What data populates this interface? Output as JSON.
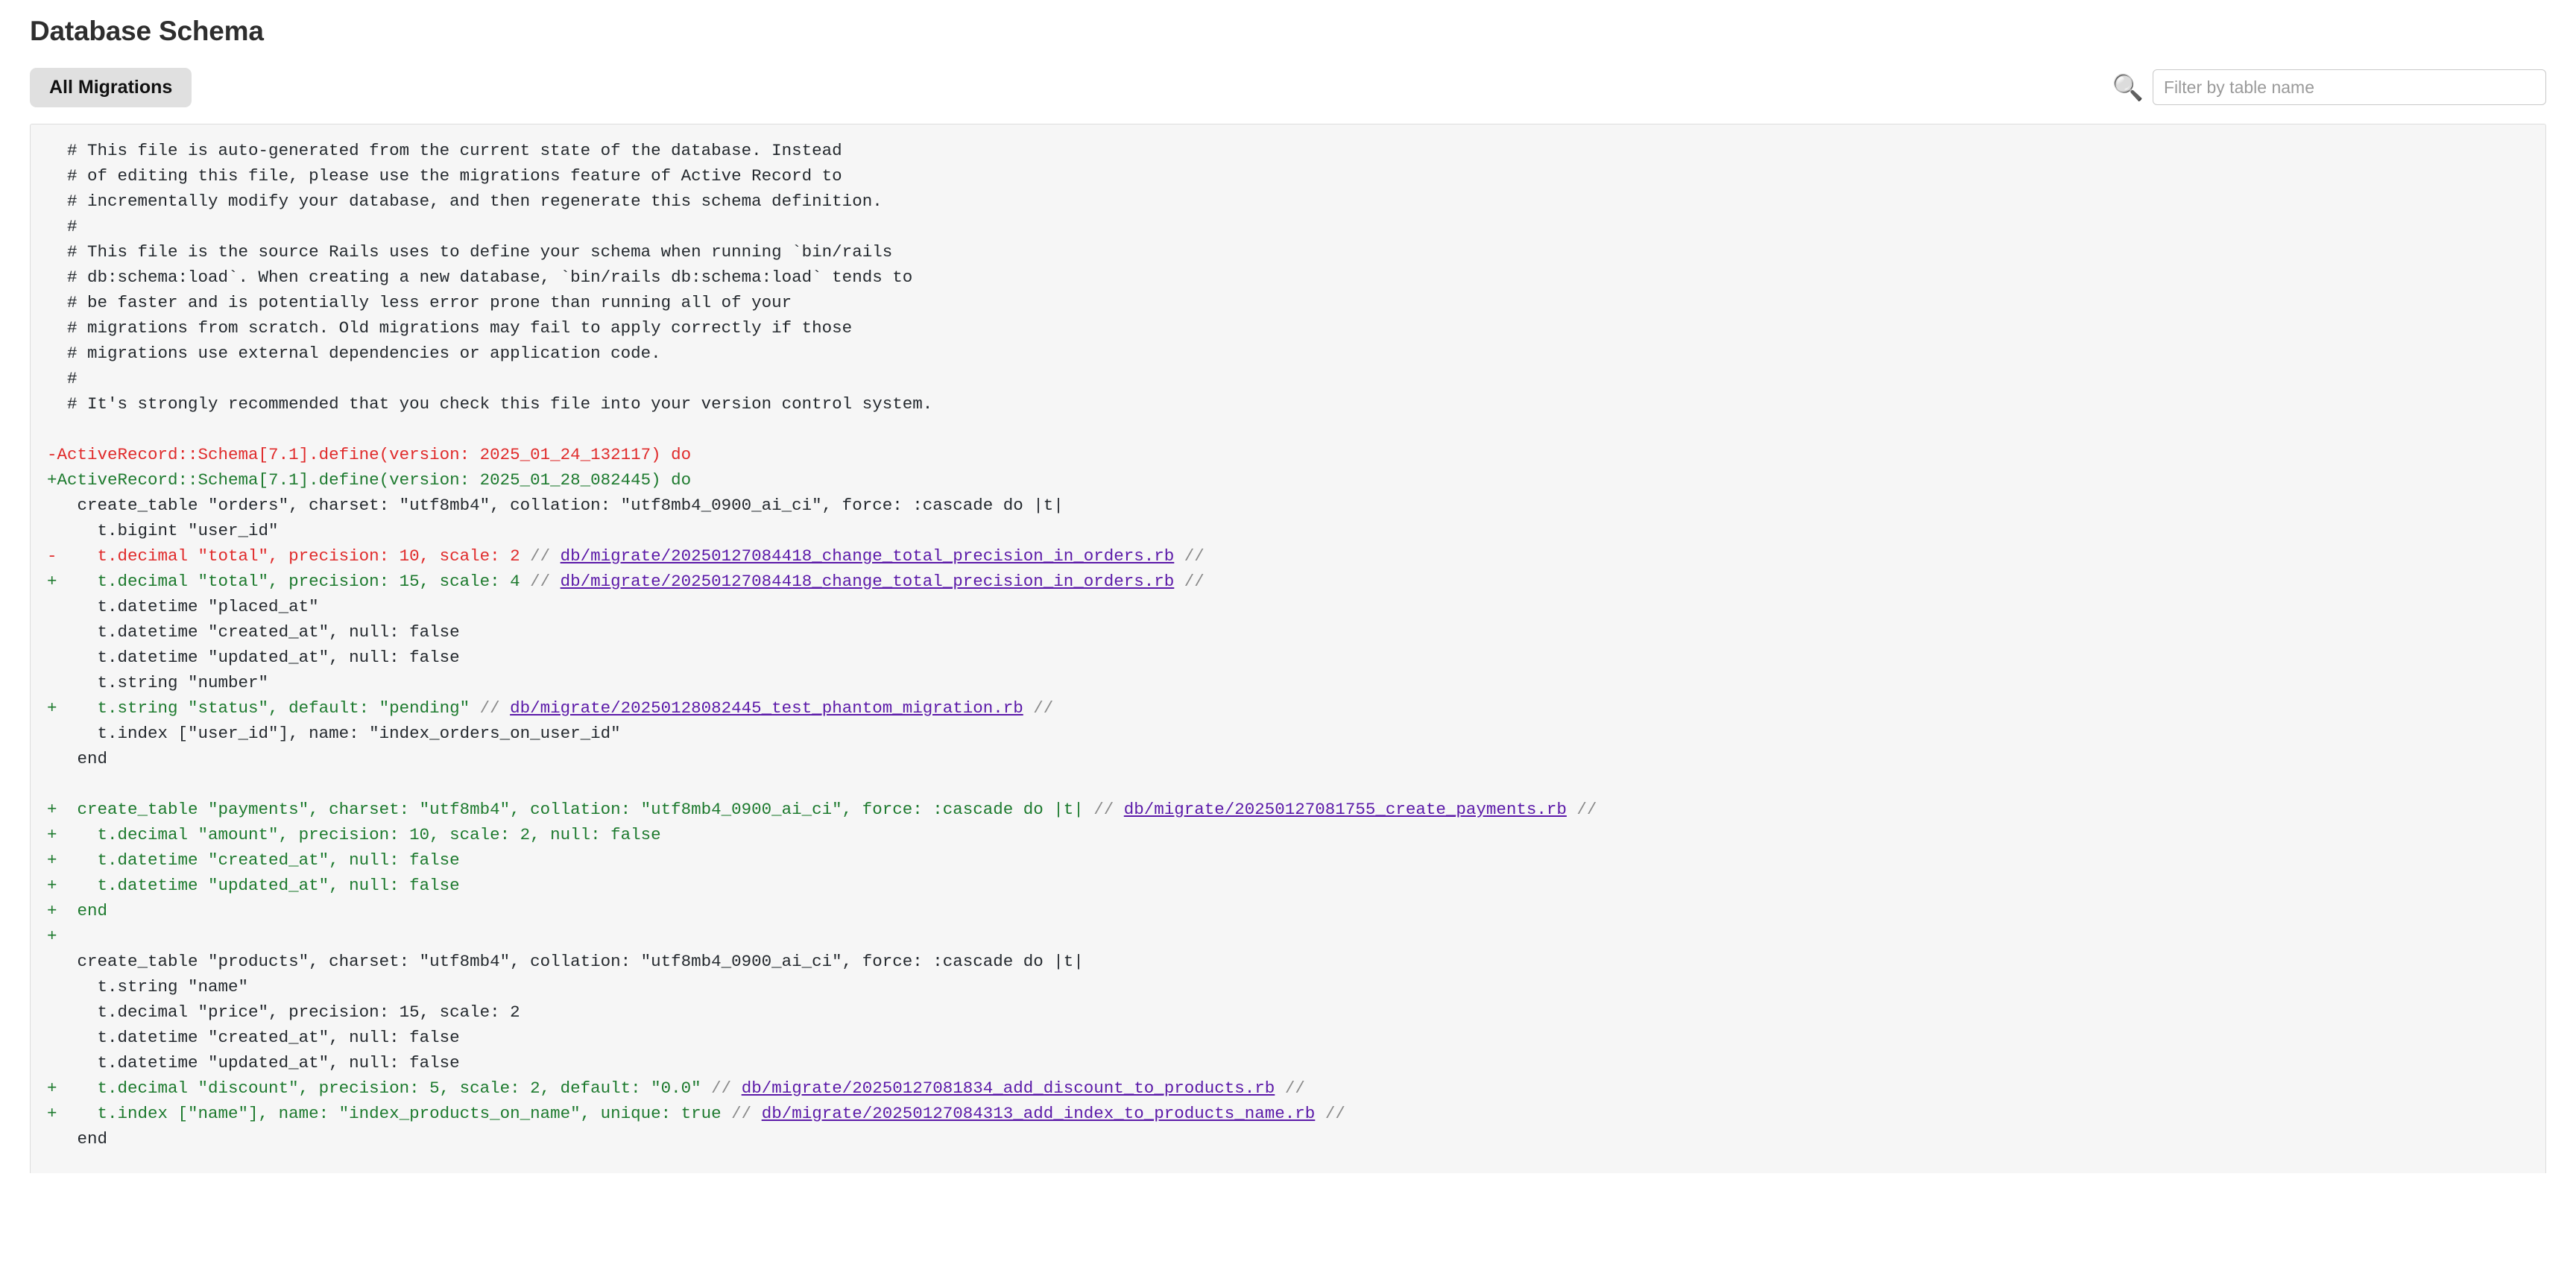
{
  "header": {
    "title": "Database Schema"
  },
  "toolbar": {
    "all_migrations_label": "All Migrations",
    "search_icon": "search-icon",
    "search_glyph": "🔍",
    "filter_placeholder": "Filter by table name",
    "filter_value": ""
  },
  "colors": {
    "addition": "#1d7a2e",
    "deletion": "#e02b2b",
    "link": "#5b19a8",
    "context": "#24292e",
    "panel_bg": "#f6f6f6",
    "panel_border": "#dddddd",
    "button_bg": "#e0e0e0"
  },
  "diff": {
    "lines": [
      {
        "type": "comment",
        "marker": "",
        "text": " # This file is auto-generated from the current state of the database. Instead"
      },
      {
        "type": "comment",
        "marker": "",
        "text": " # of editing this file, please use the migrations feature of Active Record to"
      },
      {
        "type": "comment",
        "marker": "",
        "text": " # incrementally modify your database, and then regenerate this schema definition."
      },
      {
        "type": "comment",
        "marker": "",
        "text": " #"
      },
      {
        "type": "comment",
        "marker": "",
        "text": " # This file is the source Rails uses to define your schema when running `bin/rails"
      },
      {
        "type": "comment",
        "marker": "",
        "text": " # db:schema:load`. When creating a new database, `bin/rails db:schema:load` tends to"
      },
      {
        "type": "comment",
        "marker": "",
        "text": " # be faster and is potentially less error prone than running all of your"
      },
      {
        "type": "comment",
        "marker": "",
        "text": " # migrations from scratch. Old migrations may fail to apply correctly if those"
      },
      {
        "type": "comment",
        "marker": "",
        "text": " # migrations use external dependencies or application code."
      },
      {
        "type": "comment",
        "marker": "",
        "text": " #"
      },
      {
        "type": "comment",
        "marker": "",
        "text": " # It's strongly recommended that you check this file into your version control system."
      },
      {
        "type": "blank",
        "marker": "",
        "text": ""
      },
      {
        "type": "del",
        "marker": "-",
        "text": "ActiveRecord::Schema[7.1].define(version: 2025_01_24_132117) do"
      },
      {
        "type": "add",
        "marker": "+",
        "text": "ActiveRecord::Schema[7.1].define(version: 2025_01_28_082445) do"
      },
      {
        "type": "ctx",
        "marker": "",
        "text": "  create_table \"orders\", charset: \"utf8mb4\", collation: \"utf8mb4_0900_ai_ci\", force: :cascade do |t|"
      },
      {
        "type": "ctx",
        "marker": "",
        "text": "    t.bigint \"user_id\""
      },
      {
        "type": "del",
        "marker": "-",
        "text": "    t.decimal \"total\", precision: 10, scale: 2 ",
        "sep": "// ",
        "link": "db/migrate/20250127084418_change_total_precision_in_orders.rb",
        "tail": " //"
      },
      {
        "type": "add",
        "marker": "+",
        "text": "    t.decimal \"total\", precision: 15, scale: 4 ",
        "sep": "// ",
        "link": "db/migrate/20250127084418_change_total_precision_in_orders.rb",
        "tail": " //"
      },
      {
        "type": "ctx",
        "marker": "",
        "text": "    t.datetime \"placed_at\""
      },
      {
        "type": "ctx",
        "marker": "",
        "text": "    t.datetime \"created_at\", null: false"
      },
      {
        "type": "ctx",
        "marker": "",
        "text": "    t.datetime \"updated_at\", null: false"
      },
      {
        "type": "ctx",
        "marker": "",
        "text": "    t.string \"number\""
      },
      {
        "type": "add",
        "marker": "+",
        "text": "    t.string \"status\", default: \"pending\" ",
        "sep": "// ",
        "link": "db/migrate/20250128082445_test_phantom_migration.rb",
        "tail": " //"
      },
      {
        "type": "ctx",
        "marker": "",
        "text": "    t.index [\"user_id\"], name: \"index_orders_on_user_id\""
      },
      {
        "type": "ctx",
        "marker": "",
        "text": "  end"
      },
      {
        "type": "blank",
        "marker": "",
        "text": ""
      },
      {
        "type": "add",
        "marker": "+",
        "text": "  create_table \"payments\", charset: \"utf8mb4\", collation: \"utf8mb4_0900_ai_ci\", force: :cascade do |t| ",
        "sep": "// ",
        "link": "db/migrate/20250127081755_create_payments.rb",
        "tail": " //"
      },
      {
        "type": "add",
        "marker": "+",
        "text": "    t.decimal \"amount\", precision: 10, scale: 2, null: false"
      },
      {
        "type": "add",
        "marker": "+",
        "text": "    t.datetime \"created_at\", null: false"
      },
      {
        "type": "add",
        "marker": "+",
        "text": "    t.datetime \"updated_at\", null: false"
      },
      {
        "type": "add",
        "marker": "+",
        "text": "  end"
      },
      {
        "type": "add",
        "marker": "+",
        "text": ""
      },
      {
        "type": "ctx",
        "marker": "",
        "text": "  create_table \"products\", charset: \"utf8mb4\", collation: \"utf8mb4_0900_ai_ci\", force: :cascade do |t|"
      },
      {
        "type": "ctx",
        "marker": "",
        "text": "    t.string \"name\""
      },
      {
        "type": "ctx",
        "marker": "",
        "text": "    t.decimal \"price\", precision: 15, scale: 2"
      },
      {
        "type": "ctx",
        "marker": "",
        "text": "    t.datetime \"created_at\", null: false"
      },
      {
        "type": "ctx",
        "marker": "",
        "text": "    t.datetime \"updated_at\", null: false"
      },
      {
        "type": "add",
        "marker": "+",
        "text": "    t.decimal \"discount\", precision: 5, scale: 2, default: \"0.0\" ",
        "sep": "// ",
        "link": "db/migrate/20250127081834_add_discount_to_products.rb",
        "tail": " //"
      },
      {
        "type": "add",
        "marker": "+",
        "text": "    t.index [\"name\"], name: \"index_products_on_name\", unique: true ",
        "sep": "// ",
        "link": "db/migrate/20250127084313_add_index_to_products_name.rb",
        "tail": " //"
      },
      {
        "type": "ctx",
        "marker": "",
        "text": "  end"
      }
    ]
  }
}
